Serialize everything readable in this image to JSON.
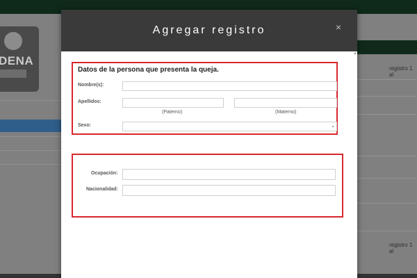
{
  "modal": {
    "title": "Agregar registro",
    "close_label": "×"
  },
  "section1": {
    "title": "Datos de la persona que presenta la queja.",
    "nombres_label": "Nombre(s):",
    "apellidos_label": "Apellidos:",
    "paterno_label": "(Paterno)",
    "materno_label": "(Materno)",
    "sexo_label": "Sexo:",
    "nombres_value": "",
    "apellido_paterno_value": "",
    "apellido_materno_value": "",
    "sexo_value": ""
  },
  "section2": {
    "ocupacion_label": "Ocupación:",
    "nacionalidad_label": "Nacionalidad:",
    "ocupacion_value": "",
    "nacionalidad_value": ""
  },
  "background": {
    "logo_text": "DENA",
    "registro_text_1": "registro 1 al",
    "registro_text_2": "registro 1 al"
  },
  "colors": {
    "header": "#3a3a3a",
    "highlight": "#d8262c",
    "topbar": "#0f2a1a"
  }
}
